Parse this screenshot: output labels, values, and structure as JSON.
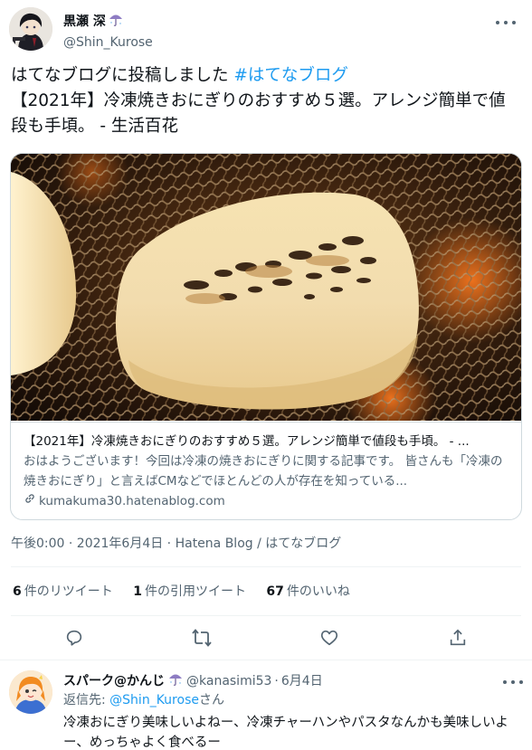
{
  "tweet": {
    "author_name": "黒瀬 深",
    "author_handle": "@Shin_Kurose",
    "text_prefix": "はてなブログに投稿しました ",
    "hashtag": "#はてなブログ",
    "text_body": "【2021年】冷凍焼きおにぎりのおすすめ５選。アレンジ簡単で値段も手頃。 - 生活百花",
    "timestamp": "午後0:00 · 2021年6月4日 · Hatena Blog / はてなブログ"
  },
  "card": {
    "title": "【2021年】冷凍焼きおにぎりのおすすめ５選。アレンジ簡単で値段も手頃。 - ...",
    "description": "おはようございます！今回は冷凍の焼きおにぎりに関する記事です。 皆さんも「冷凍の焼きおにぎり」と言えばCMなどでほとんどの人が存在を知っている...",
    "domain": "kumakuma30.hatenablog.com"
  },
  "stats": {
    "retweets_count": "6",
    "retweets_label": "件のリツイート",
    "quotes_count": "1",
    "quotes_label": "件の引用ツイート",
    "likes_count": "67",
    "likes_label": "件のいいね"
  },
  "actions": {
    "reply_icon": "reply-icon",
    "retweet_icon": "retweet-icon",
    "like_icon": "heart-icon",
    "share_icon": "share-icon"
  },
  "reply": {
    "author_name": "スパーク@かんじ",
    "author_handle": "@kanasimi53",
    "separator": "·",
    "date": "6月4日",
    "reply_to_prefix": "返信先: ",
    "reply_to_handle": "@Shin_Kurose",
    "reply_to_suffix": "さん",
    "text": "冷凍おにぎり美味しいよねー、冷凍チャーハンやパスタなんかも美味しいよー、めっちゃよく食べるー"
  },
  "colors": {
    "accent": "#1d9bf0",
    "text": "#0f1419",
    "secondary": "#536471",
    "border": "#cfd9de"
  }
}
